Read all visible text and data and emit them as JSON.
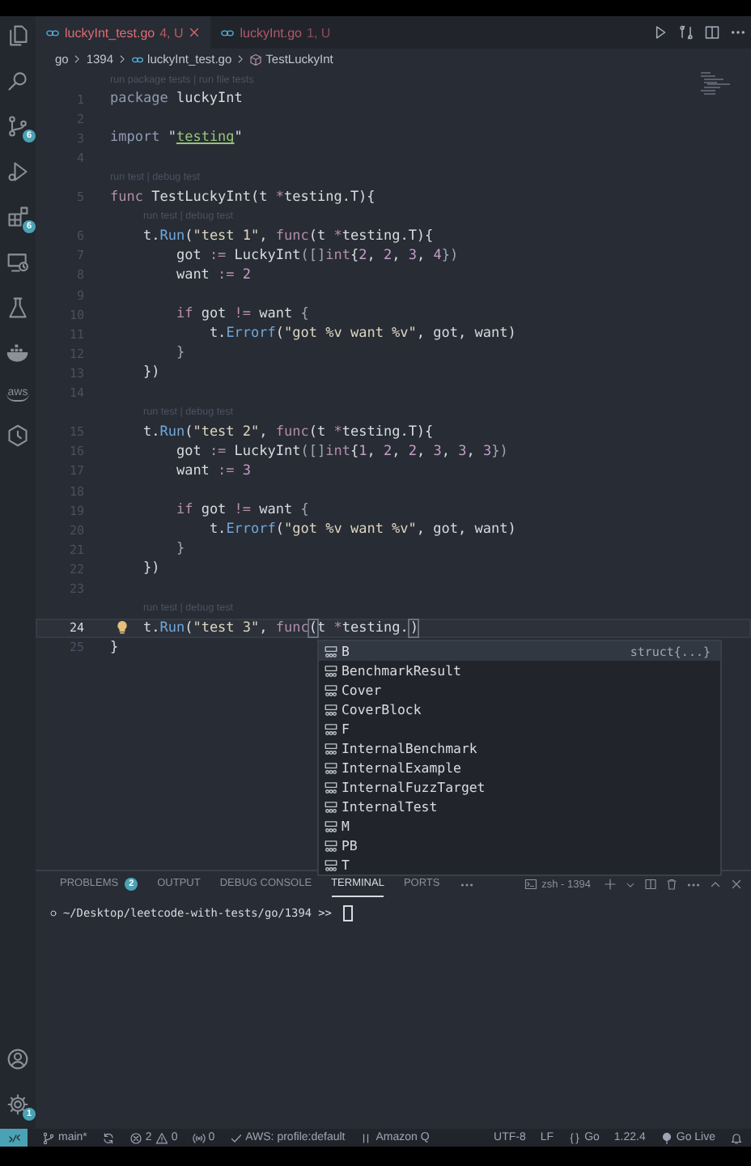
{
  "activity_bar": {
    "top": [
      {
        "kind": "files"
      },
      {
        "kind": "search"
      },
      {
        "kind": "scm",
        "badge": "6"
      },
      {
        "kind": "run"
      },
      {
        "kind": "extensions",
        "badge": "6"
      },
      {
        "kind": "remote"
      },
      {
        "kind": "flask"
      },
      {
        "kind": "docker"
      },
      {
        "kind": "aws",
        "label": "aws"
      },
      {
        "kind": "timer"
      }
    ],
    "bottom": [
      {
        "kind": "account"
      },
      {
        "kind": "gear",
        "badge": "1"
      }
    ]
  },
  "tabs": [
    {
      "label": "luckyInt_test.go",
      "badge": "4, U",
      "selected": true
    },
    {
      "label": "luckyInt.go",
      "badge": "1, U",
      "selected": false
    }
  ],
  "breadcrumb": [
    {
      "kind": "folder",
      "label": "go"
    },
    {
      "kind": "folder",
      "label": "1394"
    },
    {
      "kind": "file",
      "label": "luckyInt_test.go"
    },
    {
      "kind": "symbol",
      "label": "TestLuckyInt"
    }
  ],
  "editor": {
    "rows": [
      {
        "kind": "lens",
        "text": "run package tests | run file tests"
      },
      {
        "kind": "code",
        "number": "1",
        "current": false,
        "tokens": [
          {
            "kind": "kw",
            "text": "package"
          },
          {
            "kind": "plain",
            "text": " luckyInt"
          }
        ]
      },
      {
        "kind": "code",
        "number": "2",
        "current": false,
        "tokens": []
      },
      {
        "kind": "code",
        "number": "3",
        "current": false,
        "tokens": [
          {
            "kind": "kw",
            "text": "import"
          },
          {
            "kind": "plain",
            "text": " \""
          },
          {
            "kind": "pkg",
            "text": "testing"
          },
          {
            "kind": "plain",
            "text": "\""
          }
        ]
      },
      {
        "kind": "code",
        "number": "4",
        "current": false,
        "tokens": []
      },
      {
        "kind": "lens",
        "text": "run test | debug test"
      },
      {
        "kind": "code",
        "number": "5",
        "current": false,
        "tokens": [
          {
            "kind": "fkw",
            "text": "func"
          },
          {
            "kind": "plain",
            "text": " TestLuckyInt(t "
          },
          {
            "kind": "op",
            "text": "*"
          },
          {
            "kind": "plain",
            "text": "testing.T){"
          }
        ]
      },
      {
        "kind": "lens",
        "text": "    run test | debug test"
      },
      {
        "kind": "code",
        "number": "6",
        "current": false,
        "tokens": [
          {
            "kind": "plain",
            "text": "    t."
          },
          {
            "kind": "fn",
            "text": "Run"
          },
          {
            "kind": "plain",
            "text": "("
          },
          {
            "kind": "str",
            "text": "\"test 1\""
          },
          {
            "kind": "plain",
            "text": ", "
          },
          {
            "kind": "fkw",
            "text": "func"
          },
          {
            "kind": "plain",
            "text": "(t "
          },
          {
            "kind": "op",
            "text": "*"
          },
          {
            "kind": "plain",
            "text": "testing.T){"
          }
        ]
      },
      {
        "kind": "code",
        "number": "7",
        "current": false,
        "tokens": [
          {
            "kind": "plain",
            "text": "        got "
          },
          {
            "kind": "op",
            "text": ":="
          },
          {
            "kind": "plain",
            "text": " LuckyInt"
          },
          {
            "kind": "punct",
            "text": "([]"
          },
          {
            "kind": "fkw",
            "text": "int"
          },
          {
            "kind": "plain",
            "text": "{"
          },
          {
            "kind": "num",
            "text": "2"
          },
          {
            "kind": "plain",
            "text": ", "
          },
          {
            "kind": "num",
            "text": "2"
          },
          {
            "kind": "plain",
            "text": ", "
          },
          {
            "kind": "num",
            "text": "3"
          },
          {
            "kind": "plain",
            "text": ", "
          },
          {
            "kind": "num",
            "text": "4"
          },
          {
            "kind": "punct",
            "text": "})"
          }
        ]
      },
      {
        "kind": "code",
        "number": "8",
        "current": false,
        "tokens": [
          {
            "kind": "plain",
            "text": "        want "
          },
          {
            "kind": "op",
            "text": ":= "
          },
          {
            "kind": "num",
            "text": "2"
          }
        ]
      },
      {
        "kind": "code",
        "number": "9",
        "current": false,
        "tokens": []
      },
      {
        "kind": "code",
        "number": "10",
        "current": false,
        "tokens": [
          {
            "kind": "fkw",
            "text": "        if"
          },
          {
            "kind": "plain",
            "text": " got "
          },
          {
            "kind": "op",
            "text": "!="
          },
          {
            "kind": "plain",
            "text": " want "
          },
          {
            "kind": "punct",
            "text": "{"
          }
        ]
      },
      {
        "kind": "code",
        "number": "11",
        "current": false,
        "tokens": [
          {
            "kind": "plain",
            "text": "            t."
          },
          {
            "kind": "fn",
            "text": "Errorf"
          },
          {
            "kind": "plain",
            "text": "("
          },
          {
            "kind": "str",
            "text": "\"got %v want %v\""
          },
          {
            "kind": "plain",
            "text": ", got, want)"
          }
        ]
      },
      {
        "kind": "code",
        "number": "12",
        "current": false,
        "tokens": [
          {
            "kind": "punct",
            "text": "        }"
          }
        ]
      },
      {
        "kind": "code",
        "number": "13",
        "current": false,
        "tokens": [
          {
            "kind": "plain",
            "text": "    })"
          }
        ]
      },
      {
        "kind": "code",
        "number": "14",
        "current": false,
        "tokens": []
      },
      {
        "kind": "lens",
        "text": "    run test | debug test"
      },
      {
        "kind": "code",
        "number": "15",
        "current": false,
        "tokens": [
          {
            "kind": "plain",
            "text": "    t."
          },
          {
            "kind": "fn",
            "text": "Run"
          },
          {
            "kind": "plain",
            "text": "("
          },
          {
            "kind": "str",
            "text": "\"test 2\""
          },
          {
            "kind": "plain",
            "text": ", "
          },
          {
            "kind": "fkw",
            "text": "func"
          },
          {
            "kind": "plain",
            "text": "(t "
          },
          {
            "kind": "op",
            "text": "*"
          },
          {
            "kind": "plain",
            "text": "testing.T){"
          }
        ]
      },
      {
        "kind": "code",
        "number": "16",
        "current": false,
        "tokens": [
          {
            "kind": "plain",
            "text": "        got "
          },
          {
            "kind": "op",
            "text": ":="
          },
          {
            "kind": "plain",
            "text": " LuckyInt"
          },
          {
            "kind": "punct",
            "text": "([]"
          },
          {
            "kind": "fkw",
            "text": "int"
          },
          {
            "kind": "plain",
            "text": "{"
          },
          {
            "kind": "num",
            "text": "1"
          },
          {
            "kind": "plain",
            "text": ", "
          },
          {
            "kind": "num",
            "text": "2"
          },
          {
            "kind": "plain",
            "text": ", "
          },
          {
            "kind": "num",
            "text": "2"
          },
          {
            "kind": "plain",
            "text": ", "
          },
          {
            "kind": "num",
            "text": "3"
          },
          {
            "kind": "plain",
            "text": ", "
          },
          {
            "kind": "num",
            "text": "3"
          },
          {
            "kind": "plain",
            "text": ", "
          },
          {
            "kind": "num",
            "text": "3"
          },
          {
            "kind": "punct",
            "text": "})"
          }
        ]
      },
      {
        "kind": "code",
        "number": "17",
        "current": false,
        "tokens": [
          {
            "kind": "plain",
            "text": "        want "
          },
          {
            "kind": "op",
            "text": ":= "
          },
          {
            "kind": "num",
            "text": "3"
          }
        ]
      },
      {
        "kind": "code",
        "number": "18",
        "current": false,
        "tokens": []
      },
      {
        "kind": "code",
        "number": "19",
        "current": false,
        "tokens": [
          {
            "kind": "fkw",
            "text": "        if"
          },
          {
            "kind": "plain",
            "text": " got "
          },
          {
            "kind": "op",
            "text": "!="
          },
          {
            "kind": "plain",
            "text": " want "
          },
          {
            "kind": "punct",
            "text": "{"
          }
        ]
      },
      {
        "kind": "code",
        "number": "20",
        "current": false,
        "tokens": [
          {
            "kind": "plain",
            "text": "            t."
          },
          {
            "kind": "fn",
            "text": "Errorf"
          },
          {
            "kind": "plain",
            "text": "("
          },
          {
            "kind": "str",
            "text": "\"got %v want %v\""
          },
          {
            "kind": "plain",
            "text": ", got, want)"
          }
        ]
      },
      {
        "kind": "code",
        "number": "21",
        "current": false,
        "tokens": [
          {
            "kind": "punct",
            "text": "        }"
          }
        ]
      },
      {
        "kind": "code",
        "number": "22",
        "current": false,
        "tokens": [
          {
            "kind": "plain",
            "text": "    })"
          }
        ]
      },
      {
        "kind": "code",
        "number": "23",
        "current": false,
        "tokens": []
      },
      {
        "kind": "lens",
        "text": "    run test | debug test"
      },
      {
        "kind": "code",
        "number": "24",
        "current": true,
        "tokens": [
          {
            "kind": "plain",
            "text": "    t."
          },
          {
            "kind": "fn",
            "text": "Run"
          },
          {
            "kind": "plain",
            "text": "("
          },
          {
            "kind": "str",
            "text": "\"test 3\""
          },
          {
            "kind": "plain",
            "text": ", "
          },
          {
            "kind": "fkw",
            "text": "func"
          },
          {
            "kind": "plain",
            "text": "(",
            "match": true
          },
          {
            "kind": "plain",
            "text": "t "
          },
          {
            "kind": "op",
            "text": "*"
          },
          {
            "kind": "plain",
            "text": "testing.",
            "cursor": true
          },
          {
            "kind": "plain",
            "text": ")",
            "match": true
          }
        ]
      },
      {
        "kind": "code",
        "number": "25",
        "current": false,
        "tokens": [
          {
            "kind": "plain",
            "text": "}"
          }
        ]
      }
    ]
  },
  "suggestions": [
    {
      "label": "B",
      "detail": "struct{...}",
      "selected": true
    },
    {
      "label": "BenchmarkResult",
      "selected": false
    },
    {
      "label": "Cover",
      "selected": false
    },
    {
      "label": "CoverBlock",
      "selected": false
    },
    {
      "label": "F",
      "selected": false
    },
    {
      "label": "InternalBenchmark",
      "selected": false
    },
    {
      "label": "InternalExample",
      "selected": false
    },
    {
      "label": "InternalFuzzTarget",
      "selected": false
    },
    {
      "label": "InternalTest",
      "selected": false
    },
    {
      "label": "M",
      "selected": false
    },
    {
      "label": "PB",
      "selected": false
    },
    {
      "label": "T",
      "selected": false
    }
  ],
  "panel": {
    "tabs": [
      {
        "label": "PROBLEMS",
        "badge": "2",
        "selected": false
      },
      {
        "label": "OUTPUT",
        "selected": false
      },
      {
        "label": "DEBUG CONSOLE",
        "selected": false
      },
      {
        "label": "TERMINAL",
        "selected": true
      },
      {
        "label": "PORTS",
        "selected": false
      }
    ],
    "terminal_name": "zsh - 1394",
    "terminal_line": "~/Desktop/leetcode-with-tests/go/1394 >> "
  },
  "status_bar": [
    {
      "kind": "remote"
    },
    {
      "kind": "branch",
      "text": "main*"
    },
    {
      "kind": "sync"
    },
    {
      "kind": "problems",
      "errors": "2",
      "warnings": "0"
    },
    {
      "kind": "ports",
      "text": "0"
    },
    {
      "kind": "check",
      "text": "AWS: profile:default"
    },
    {
      "kind": "pause",
      "text": "Amazon Q"
    },
    {
      "kind": "spacer"
    },
    {
      "kind": "plain",
      "text": "UTF-8"
    },
    {
      "kind": "plain",
      "text": "LF"
    },
    {
      "kind": "braces",
      "text": "Go"
    },
    {
      "kind": "plain",
      "text": "1.22.4"
    },
    {
      "kind": "broadcast",
      "text": "Go Live"
    },
    {
      "kind": "bell"
    }
  ]
}
